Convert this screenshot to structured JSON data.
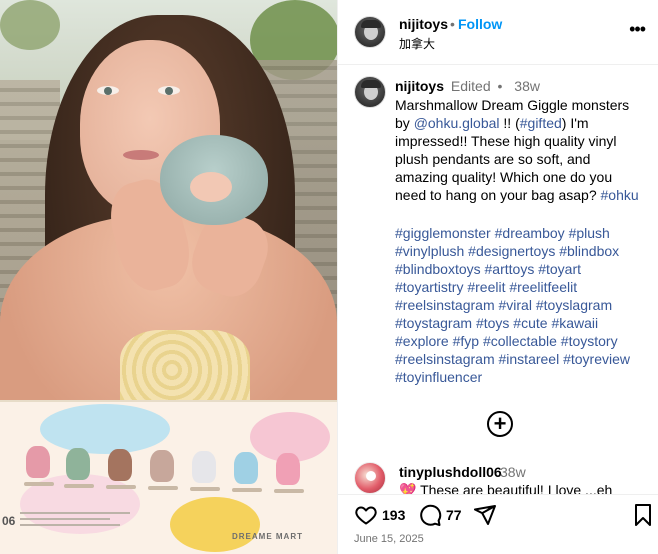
{
  "media": {
    "box_number": "06",
    "box_brand": "DREAME MART"
  },
  "header": {
    "username": "nijitoys",
    "separator": "•",
    "follow_label": "Follow",
    "location": "加拿大",
    "more_icon": "more-horizontal-icon"
  },
  "caption": {
    "username": "nijitoys",
    "edited": "Edited",
    "separator": "•",
    "time": "38w",
    "text_part1": "Marshmallow Dream Giggle monsters by ",
    "mention": "@ohku.global",
    "text_part2": " !! (",
    "gifted_tag": "#gifted",
    "text_part3": ") I'm impressed!! These high quality vinyl plush pendants are so soft, and amazing quality! Which one do you need to hang on your bag asap? ",
    "ohku_tag": "#ohku",
    "hashtags": [
      "#gigglemonster",
      "#dreamboy",
      "#plush",
      "#vinylplush",
      "#designertoys",
      "#blindbox",
      "#blindboxtoys",
      "#arttoys",
      "#toyart",
      "#toyartistry",
      "#reelit",
      "#reelitfeelit",
      "#reelsinstagram",
      "#viral",
      "#toyslagram",
      "#toystagram",
      "#toys",
      "#cute",
      "#kawaii",
      "#explore",
      "#fyp",
      "#collectable",
      "#toystory",
      "#reelsinstagram",
      "#instareel",
      "#toyreview",
      "#toyinfluencer"
    ]
  },
  "comment": {
    "username": "tinyplushdoll06",
    "time": "38w",
    "emoji": "💖",
    "text": " These are beautiful! I love ...eh"
  },
  "actions": {
    "likes": "193",
    "comments": "77"
  },
  "date": "June 15, 2025",
  "colors": {
    "follow": "#0095f6",
    "link": "#385898",
    "muted": "#737373"
  }
}
